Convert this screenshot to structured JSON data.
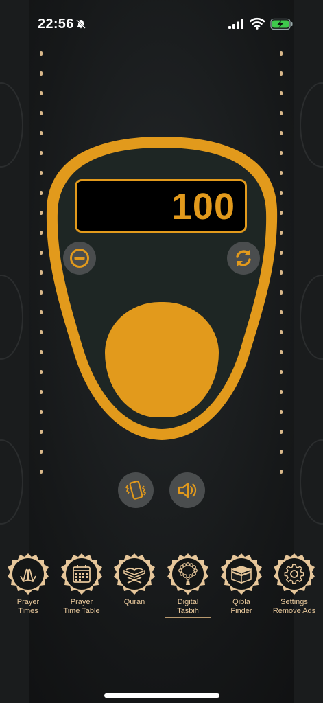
{
  "status_bar": {
    "time": "22:56",
    "bell_icon": "bell-slash-icon",
    "signal_icon": "cellular-signal-icon",
    "wifi_icon": "wifi-icon",
    "battery_icon": "battery-charging-icon"
  },
  "counter": {
    "value": "100",
    "decrement_icon": "minus-circle-icon",
    "reset_icon": "refresh-icon",
    "tap_button": "tap-counter-button",
    "vibrate_icon": "phone-vibrate-icon",
    "sound_icon": "speaker-icon"
  },
  "colors": {
    "accent": "#e29a1c",
    "device_body": "#1e2624",
    "nav_text": "#e6c69a",
    "control_bg": "#4a4d4e"
  },
  "nav": {
    "items": [
      {
        "label": "Prayer\nTimes",
        "icon": "praying-hands-icon"
      },
      {
        "label": "Prayer\nTime Table",
        "icon": "calendar-icon"
      },
      {
        "label": "Quran",
        "icon": "quran-book-icon"
      },
      {
        "label": "Digital\nTasbih",
        "icon": "tasbih-beads-icon",
        "active": true
      },
      {
        "label": "Qibla\nFinder",
        "icon": "kaaba-icon"
      },
      {
        "label": "Settings\nRemove Ads",
        "icon": "gear-icon"
      }
    ]
  }
}
